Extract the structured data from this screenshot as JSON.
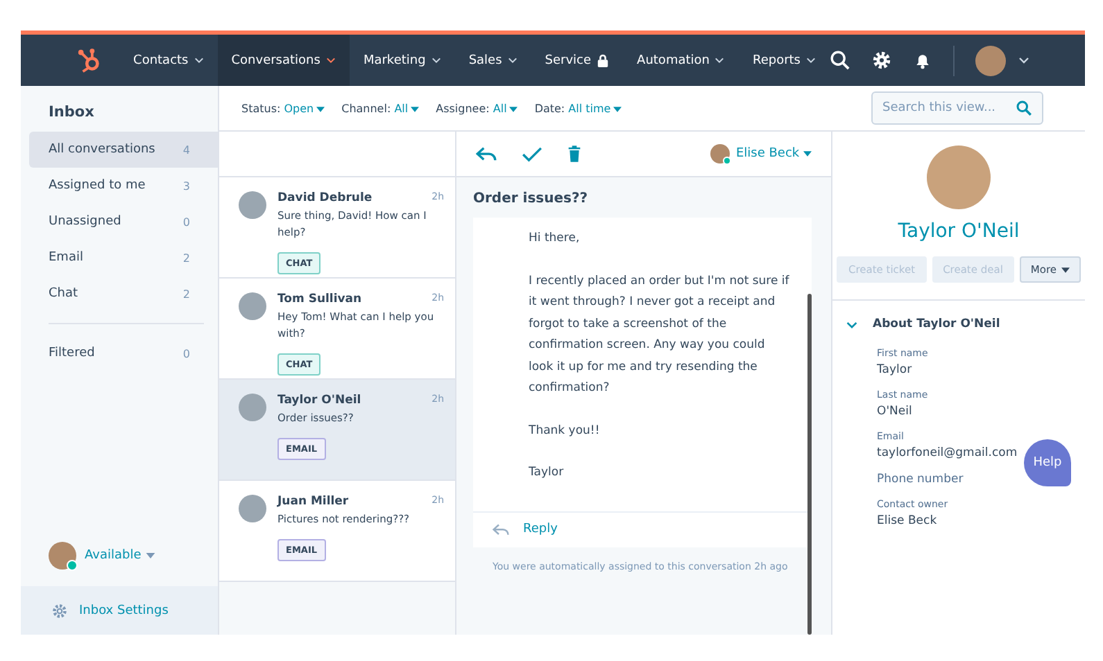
{
  "nav": {
    "items": [
      {
        "label": "Contacts",
        "selected": false,
        "caret": true,
        "locked": false
      },
      {
        "label": "Conversations",
        "selected": true,
        "caret": true,
        "locked": false
      },
      {
        "label": "Marketing",
        "selected": false,
        "caret": true,
        "locked": false
      },
      {
        "label": "Sales",
        "selected": false,
        "caret": true,
        "locked": false
      },
      {
        "label": "Service",
        "selected": false,
        "caret": false,
        "locked": true
      },
      {
        "label": "Automation",
        "selected": false,
        "caret": true,
        "locked": false
      },
      {
        "label": "Reports",
        "selected": false,
        "caret": true,
        "locked": false
      }
    ]
  },
  "sidebar": {
    "title": "Inbox",
    "groups": [
      [
        {
          "label": "All conversations",
          "count": "4",
          "selected": true
        },
        {
          "label": "Assigned to me",
          "count": "3",
          "selected": false
        },
        {
          "label": "Unassigned",
          "count": "0",
          "selected": false
        },
        {
          "label": "Email",
          "count": "2",
          "selected": false
        },
        {
          "label": "Chat",
          "count": "2",
          "selected": false
        }
      ],
      [
        {
          "label": "Filtered",
          "count": "0",
          "selected": false
        }
      ]
    ],
    "status": "Available",
    "settings": "Inbox Settings"
  },
  "filters": [
    {
      "label": "Status:",
      "value": "Open"
    },
    {
      "label": "Channel:",
      "value": "All"
    },
    {
      "label": "Assignee:",
      "value": "All"
    },
    {
      "label": "Date:",
      "value": "All time"
    }
  ],
  "search": {
    "placeholder": "Search this view..."
  },
  "conversations": [
    {
      "name": "David Debrule",
      "time": "2h",
      "preview": "Sure thing, David! How can I help?",
      "tag": "CHAT",
      "kind": "chat",
      "selected": false
    },
    {
      "name": "Tom Sullivan",
      "time": "2h",
      "preview": "Hey Tom! What can I help you with?",
      "tag": "CHAT",
      "kind": "chat",
      "selected": false
    },
    {
      "name": "Taylor O'Neil",
      "time": "2h",
      "preview": "Order issues??",
      "tag": "EMAIL",
      "kind": "email",
      "selected": true
    },
    {
      "name": "Juan Miller",
      "time": "2h",
      "preview": "Pictures not rendering???",
      "tag": "EMAIL",
      "kind": "email",
      "selected": false
    }
  ],
  "thread": {
    "assignee": "Elise Beck",
    "subject": "Order issues??",
    "paragraphs": [
      "Hi there,",
      "I recently placed an order but I'm not sure if it went through? I never got a receipt and forgot to take a screenshot of the confirmation screen. Any way you could look it up for me and try resending the confirmation?",
      "Thank you!!",
      "Taylor"
    ],
    "reply": "Reply",
    "note": "You were automatically assigned to this conversation 2h ago"
  },
  "contact": {
    "name": "Taylor O'Neil",
    "buttons": [
      {
        "label": "Create ticket",
        "disabled": true,
        "caret": false
      },
      {
        "label": "Create deal",
        "disabled": true,
        "caret": false
      },
      {
        "label": "More",
        "disabled": false,
        "caret": true
      }
    ],
    "section": "About Taylor O'Neil",
    "expanded": true,
    "fields": [
      {
        "label": "First name",
        "value": "Taylor"
      },
      {
        "label": "Last name",
        "value": "O'Neil"
      },
      {
        "label": "Email",
        "value": "taylorfoneil@gmail.com"
      },
      {
        "label": "Phone number"
      },
      {
        "label": "Contact owner",
        "value": "Elise Beck"
      }
    ]
  },
  "help": "Help"
}
